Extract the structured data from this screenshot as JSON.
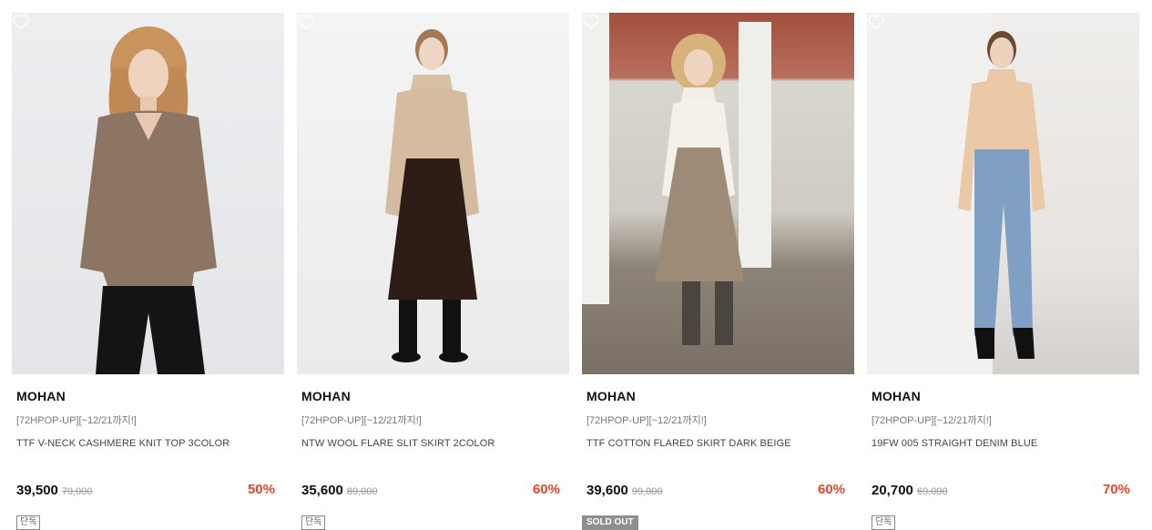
{
  "products": [
    {
      "brand": "MOHAN",
      "promo": "[72HPOP-UP][~12/21까지!]",
      "name": "TTF V-NECK CASHMERE KNIT TOP 3COLOR",
      "price": "39,500",
      "original_price": "79,000",
      "discount": "50%",
      "badge": "단독",
      "sold_out": false
    },
    {
      "brand": "MOHAN",
      "promo": "[72HPOP-UP][~12/21까지!]",
      "name": "NTW WOOL FLARE SLIT SKIRT 2COLOR",
      "price": "35,600",
      "original_price": "89,000",
      "discount": "60%",
      "badge": "단독",
      "sold_out": false
    },
    {
      "brand": "MOHAN",
      "promo": "[72HPOP-UP][~12/21까지!]",
      "name": "TTF COTTON FLARED SKIRT DARK BEIGE",
      "price": "39,600",
      "original_price": "99,000",
      "discount": "60%",
      "badge": "SOLD OUT",
      "sold_out": true
    },
    {
      "brand": "MOHAN",
      "promo": "[72HPOP-UP][~12/21까지!]",
      "name": "19FW 005 STRAIGHT DENIM BLUE",
      "price": "20,700",
      "original_price": "69,000",
      "discount": "70%",
      "badge": "단독",
      "sold_out": false
    }
  ],
  "colors": {
    "discount": "#e8462b",
    "sold_out_bg": "#8f8f8f"
  },
  "icons": {
    "wishlist": "heart-outline-icon"
  }
}
